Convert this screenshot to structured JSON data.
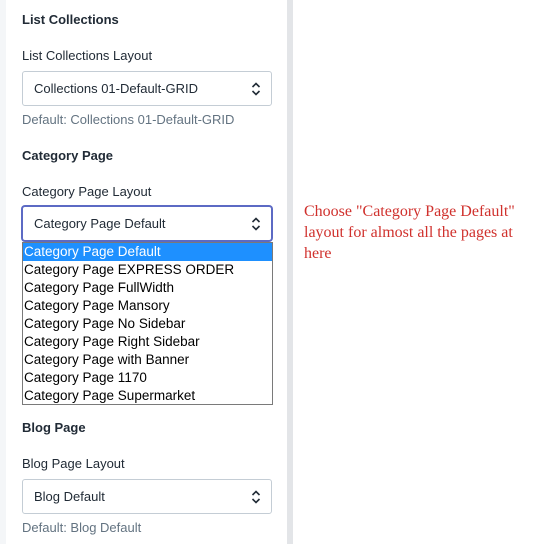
{
  "sections": {
    "list_collections": {
      "title": "List Collections",
      "field_label": "List Collections Layout",
      "selected_value": "Collections 01-Default-GRID",
      "help": "Default: Collections 01-Default-GRID"
    },
    "category_page": {
      "title": "Category Page",
      "field_label": "Category Page Layout",
      "selected_value": "Category Page Default",
      "options": [
        "Category Page Default",
        "Category Page EXPRESS ORDER",
        "Category Page FullWidth",
        "Category Page Mansory",
        "Category Page No Sidebar",
        "Category Page Right Sidebar",
        "Category Page with Banner",
        "Category Page 1170",
        "Category Page Supermarket"
      ]
    },
    "blog_page": {
      "title": "Blog Page",
      "field_label": "Blog Page Layout",
      "selected_value": "Blog Default",
      "help": "Default: Blog Default"
    }
  },
  "annotation": {
    "text": "Choose \"Category Page Default\" layout for almost all the pages at here",
    "color": "#d0312d"
  },
  "colors": {
    "selected_option_bg": "#1e90ff",
    "focus_border": "#5c6ac4"
  },
  "icons": {
    "select_arrow": "up-down-chevron-icon"
  }
}
